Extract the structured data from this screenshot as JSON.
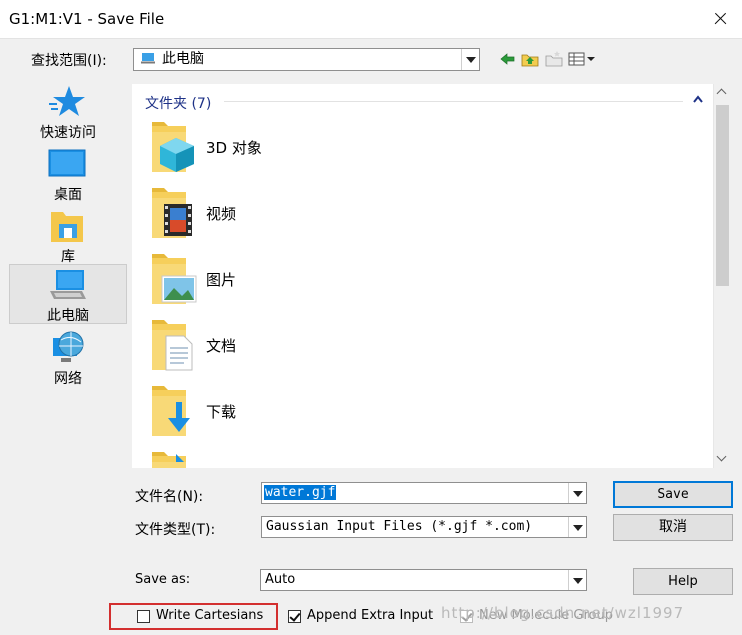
{
  "window": {
    "title": "G1:M1:V1 - Save File"
  },
  "lookin": {
    "label": "查找范围(I):",
    "value": "此电脑"
  },
  "toolbar": {
    "icons": [
      "back-icon",
      "up-folder-icon",
      "new-folder-icon",
      "view-menu-icon"
    ]
  },
  "places": [
    {
      "label": "快速访问",
      "icon": "star-icon"
    },
    {
      "label": "桌面",
      "icon": "desktop-icon"
    },
    {
      "label": "库",
      "icon": "library-icon"
    },
    {
      "label": "此电脑",
      "icon": "this-pc-icon",
      "selected": true
    },
    {
      "label": "网络",
      "icon": "network-icon"
    }
  ],
  "filelist": {
    "group_label": "文件夹 (7)",
    "items": [
      "3D 对象",
      "视频",
      "图片",
      "文档",
      "下载"
    ]
  },
  "filename": {
    "label": "文件名(N):",
    "value": "water.gjf"
  },
  "filetype": {
    "label": "文件类型(T):",
    "value": "Gaussian Input Files (*.gjf *.com)"
  },
  "saveas": {
    "label": "Save as:",
    "value": "Auto"
  },
  "buttons": {
    "save": "Save",
    "cancel": "取消",
    "help": "Help"
  },
  "options": {
    "write_cartesians": {
      "label": "Write Cartesians",
      "checked": false
    },
    "append_extra": {
      "label": "Append Extra Input",
      "checked": true
    },
    "new_molecule_group": {
      "label": "New Molecule Group",
      "checked": true,
      "disabled": true
    }
  },
  "watermark": "http://blog.csdn.net/wzl1997",
  "colors": {
    "accent": "#0078d7",
    "highlight_border": "#d32f2f",
    "group_header": "#1e3287"
  }
}
